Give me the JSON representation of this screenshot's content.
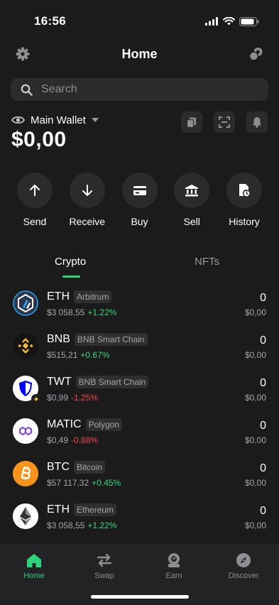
{
  "status_bar": {
    "time": "16:56"
  },
  "header": {
    "title": "Home",
    "left_icon": "gear-icon",
    "right_icon": "coins-icon"
  },
  "search": {
    "placeholder": "Search"
  },
  "wallet": {
    "name": "Main Wallet",
    "balance": "$0,00"
  },
  "actions": [
    {
      "label": "Send",
      "icon": "arrow-up-icon"
    },
    {
      "label": "Receive",
      "icon": "arrow-down-icon"
    },
    {
      "label": "Buy",
      "icon": "card-icon"
    },
    {
      "label": "Sell",
      "icon": "bank-icon"
    },
    {
      "label": "History",
      "icon": "history-icon"
    }
  ],
  "tabs": [
    {
      "label": "Crypto",
      "active": true
    },
    {
      "label": "NFTs",
      "active": false
    }
  ],
  "assets": [
    {
      "symbol": "ETH",
      "network": "Arbitrum",
      "price": "$3 058,55",
      "change": "+1.22%",
      "amount": "0",
      "value": "$0,00",
      "color": "#2d374b",
      "icon": "arbitrum-icon"
    },
    {
      "symbol": "BNB",
      "network": "BNB Smart Chain",
      "price": "$515,21",
      "change": "+0.67%",
      "amount": "0",
      "value": "$0,00",
      "color": "#1e1e1e",
      "icon": "bnb-icon"
    },
    {
      "symbol": "TWT",
      "network": "BNB Smart Chain",
      "price": "$0,99",
      "change": "-1.25%",
      "amount": "0",
      "value": "$0,00",
      "color": "#ffffff",
      "icon": "twt-shield-icon"
    },
    {
      "symbol": "MATIC",
      "network": "Polygon",
      "price": "$0,49",
      "change": "-0.88%",
      "amount": "0",
      "value": "$0,00",
      "color": "#ffffff",
      "icon": "polygon-icon"
    },
    {
      "symbol": "BTC",
      "network": "Bitcoin",
      "price": "$57 117,32",
      "change": "+0.45%",
      "amount": "0",
      "value": "$0,00",
      "color": "#f7931a",
      "icon": "bitcoin-icon"
    },
    {
      "symbol": "ETH",
      "network": "Ethereum",
      "price": "$3 058,55",
      "change": "+1.22%",
      "amount": "0",
      "value": "$0,00",
      "color": "#ffffff",
      "icon": "ethereum-icon"
    }
  ],
  "bottom_nav": [
    {
      "label": "Home",
      "icon": "home-icon",
      "active": true
    },
    {
      "label": "Swap",
      "icon": "swap-icon",
      "active": false
    },
    {
      "label": "Earn",
      "icon": "earn-icon",
      "active": false
    },
    {
      "label": "Discover",
      "icon": "compass-icon",
      "active": false
    }
  ],
  "colors": {
    "accent": "#2fd47d",
    "positive": "#3bd67e",
    "negative": "#f0484d",
    "background": "#1b1b1c",
    "surface": "#2b2b2d"
  }
}
